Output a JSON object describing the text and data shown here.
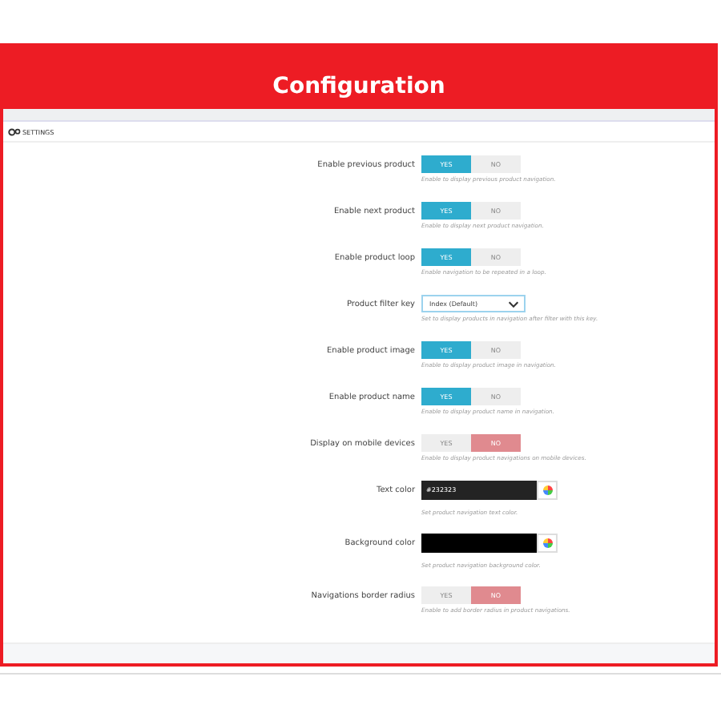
{
  "header": {
    "title": "Configuration"
  },
  "panel": {
    "heading": "SETTINGS"
  },
  "rows": [
    {
      "kind": "toggle",
      "label": "Enable previous product",
      "options": [
        {
          "label": "YES",
          "selected": true
        },
        {
          "label": "NO",
          "selected": false
        }
      ],
      "help": "Enable to display previous product navigation."
    },
    {
      "kind": "toggle",
      "label": "Enable next product",
      "options": [
        {
          "label": "YES",
          "selected": true
        },
        {
          "label": "NO",
          "selected": false
        }
      ],
      "help": "Enable to display next product navigation."
    },
    {
      "kind": "toggle",
      "label": "Enable product loop",
      "options": [
        {
          "label": "YES",
          "selected": true
        },
        {
          "label": "NO",
          "selected": false
        }
      ],
      "help": "Enable navigation to be repeated in a loop."
    },
    {
      "kind": "select",
      "label": "Product filter key",
      "value": "Index (Default)",
      "help": "Set to display products in navigation after filter with this key."
    },
    {
      "kind": "toggle",
      "label": "Enable product image",
      "options": [
        {
          "label": "YES",
          "selected": true
        },
        {
          "label": "NO",
          "selected": false
        }
      ],
      "help": "Enable to display product image in navigation."
    },
    {
      "kind": "toggle",
      "label": "Enable product name",
      "options": [
        {
          "label": "YES",
          "selected": true
        },
        {
          "label": "NO",
          "selected": false
        }
      ],
      "help": "Enable to display product name in navigation."
    },
    {
      "kind": "toggle",
      "label": "Display on mobile devices",
      "options": [
        {
          "label": "YES",
          "selected": false
        },
        {
          "label": "NO",
          "selected": true
        }
      ],
      "help": "Enable to display product navigations on mobile devices."
    },
    {
      "kind": "color",
      "label": "Text color",
      "value": "#232323",
      "color": "#232323",
      "help": "Set product navigation text color."
    },
    {
      "kind": "color",
      "label": "Background color",
      "color": "#000000",
      "help": "Set product navigation background color."
    },
    {
      "kind": "toggle",
      "label": "Navigations border radius",
      "options": [
        {
          "label": "YES",
          "selected": false
        },
        {
          "label": "NO",
          "selected": true
        }
      ],
      "help": "Enable to add border radius in product navigations."
    }
  ]
}
